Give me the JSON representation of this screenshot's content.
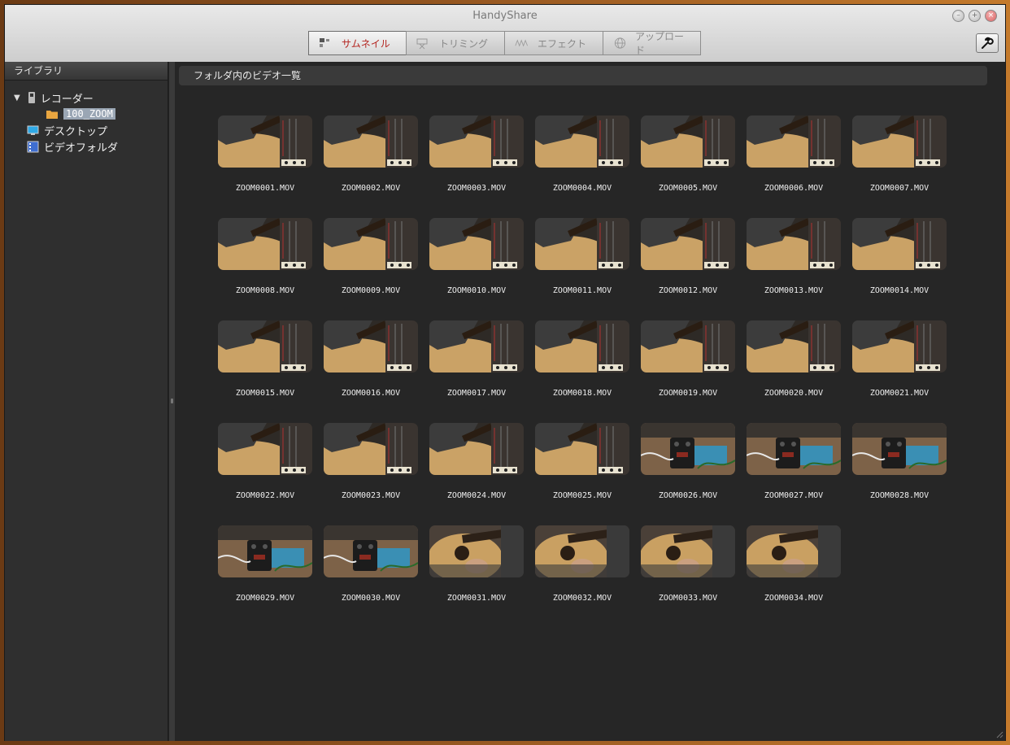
{
  "window": {
    "title": "HandyShare"
  },
  "toolbar": {
    "tabs": [
      {
        "label": "サムネイル",
        "icon": "thumbnail-grid-icon"
      },
      {
        "label": "トリミング",
        "icon": "film-scissors-icon"
      },
      {
        "label": "エフェクト",
        "icon": "wave-pattern-icon"
      },
      {
        "label": "アップロード",
        "icon": "globe-upload-icon"
      }
    ],
    "settings_icon": "wrench-icon"
  },
  "sidebar": {
    "header": "ライブラリ",
    "tree": {
      "recorder": "レコーダー",
      "folder": "100_ZOOM",
      "desktop": "デスクトップ",
      "videos": "ビデオフォルダ"
    }
  },
  "main": {
    "header": "フォルダ内のビデオ一覧",
    "videos": [
      {
        "name": "ZOOM0001.MOV",
        "kind": "guitar-closeup"
      },
      {
        "name": "ZOOM0002.MOV",
        "kind": "guitar-closeup"
      },
      {
        "name": "ZOOM0003.MOV",
        "kind": "guitar-closeup"
      },
      {
        "name": "ZOOM0004.MOV",
        "kind": "guitar-closeup"
      },
      {
        "name": "ZOOM0005.MOV",
        "kind": "guitar-closeup"
      },
      {
        "name": "ZOOM0006.MOV",
        "kind": "guitar-closeup"
      },
      {
        "name": "ZOOM0007.MOV",
        "kind": "guitar-closeup"
      },
      {
        "name": "ZOOM0008.MOV",
        "kind": "guitar-closeup"
      },
      {
        "name": "ZOOM0009.MOV",
        "kind": "guitar-closeup"
      },
      {
        "name": "ZOOM0010.MOV",
        "kind": "guitar-closeup"
      },
      {
        "name": "ZOOM0011.MOV",
        "kind": "guitar-closeup"
      },
      {
        "name": "ZOOM0012.MOV",
        "kind": "guitar-closeup"
      },
      {
        "name": "ZOOM0013.MOV",
        "kind": "guitar-closeup"
      },
      {
        "name": "ZOOM0014.MOV",
        "kind": "guitar-closeup"
      },
      {
        "name": "ZOOM0015.MOV",
        "kind": "guitar-closeup"
      },
      {
        "name": "ZOOM0016.MOV",
        "kind": "guitar-closeup"
      },
      {
        "name": "ZOOM0017.MOV",
        "kind": "guitar-closeup"
      },
      {
        "name": "ZOOM0018.MOV",
        "kind": "guitar-closeup"
      },
      {
        "name": "ZOOM0019.MOV",
        "kind": "guitar-closeup"
      },
      {
        "name": "ZOOM0020.MOV",
        "kind": "guitar-closeup"
      },
      {
        "name": "ZOOM0021.MOV",
        "kind": "guitar-closeup"
      },
      {
        "name": "ZOOM0022.MOV",
        "kind": "guitar-closeup"
      },
      {
        "name": "ZOOM0023.MOV",
        "kind": "guitar-closeup"
      },
      {
        "name": "ZOOM0024.MOV",
        "kind": "guitar-closeup"
      },
      {
        "name": "ZOOM0025.MOV",
        "kind": "guitar-closeup"
      },
      {
        "name": "ZOOM0026.MOV",
        "kind": "pedal-desk"
      },
      {
        "name": "ZOOM0027.MOV",
        "kind": "pedal-desk"
      },
      {
        "name": "ZOOM0028.MOV",
        "kind": "pedal-desk"
      },
      {
        "name": "ZOOM0029.MOV",
        "kind": "pedal-desk"
      },
      {
        "name": "ZOOM0030.MOV",
        "kind": "pedal-desk"
      },
      {
        "name": "ZOOM0031.MOV",
        "kind": "guitar-strum"
      },
      {
        "name": "ZOOM0032.MOV",
        "kind": "guitar-strum"
      },
      {
        "name": "ZOOM0033.MOV",
        "kind": "guitar-strum"
      },
      {
        "name": "ZOOM0034.MOV",
        "kind": "guitar-strum"
      }
    ]
  }
}
